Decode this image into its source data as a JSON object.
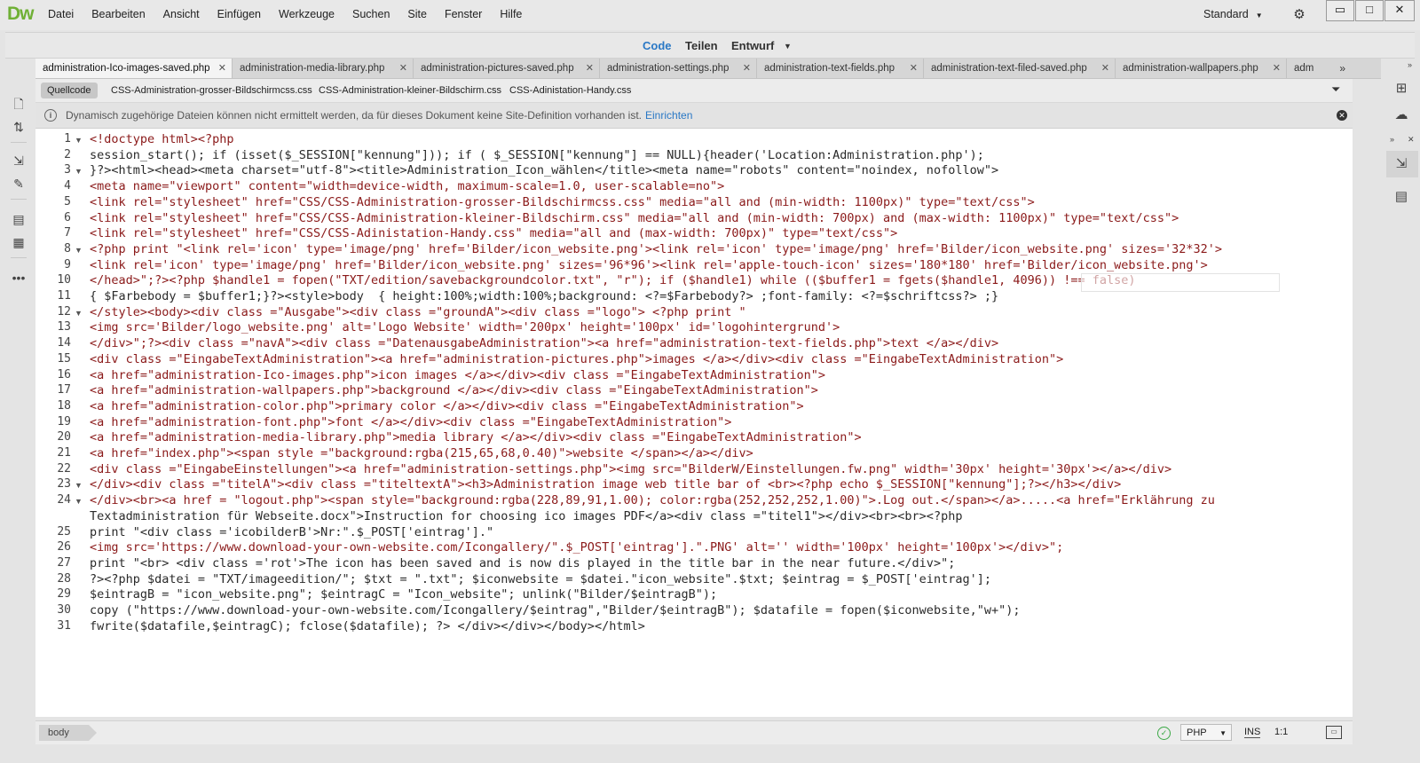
{
  "app": {
    "logo": "Dw",
    "menu": [
      "Datei",
      "Bearbeiten",
      "Ansicht",
      "Einfügen",
      "Werkzeuge",
      "Suchen",
      "Site",
      "Fenster",
      "Hilfe"
    ],
    "workspace": "Standard",
    "window_buttons": {
      "minimize": "▭",
      "maximize": "□",
      "close": "✕"
    }
  },
  "views": {
    "code": "Code",
    "split": "Teilen",
    "design": "Entwurf"
  },
  "tabs": [
    "administration-Ico-images-saved.php",
    "administration-media-library.php",
    "administration-pictures-saved.php",
    "administration-settings.php",
    "administration-text-fields.php",
    "administration-text-filed-saved.php",
    "administration-wallpapers.php",
    "adm"
  ],
  "tab_close": "✕",
  "tabs_more": "»",
  "related_files": [
    "Quellcode",
    "CSS-Administration-grosser-Bildschirmcss.css",
    "CSS-Administration-kleiner-Bildschirm.css",
    "CSS-Adinistation-Handy.css"
  ],
  "info_bar": {
    "message": "Dynamisch zugehörige Dateien können nicht ermittelt werden, da für dieses Dokument keine Site-Definition vorhanden ist.",
    "link": "Einrichten"
  },
  "code_lines": [
    {
      "n": "1",
      "fold": true,
      "text": "<!doctype html><?php"
    },
    {
      "n": "2",
      "fold": false,
      "text": "session_start(); if (isset($_SESSION[\"kennung\"])); if ( $_SESSION[\"kennung\"] == NULL){header('Location:Administration.php');"
    },
    {
      "n": "3",
      "fold": true,
      "text": "}?><html><head><meta charset=\"utf-8\"><title>Administration_Icon_wählen</title><meta name=\"robots\" content=\"noindex, nofollow\">"
    },
    {
      "n": "4",
      "fold": false,
      "text": "<meta name=\"viewport\" content=\"width=device-width, maximum-scale=1.0, user-scalable=no\">"
    },
    {
      "n": "5",
      "fold": false,
      "text": "<link rel=\"stylesheet\" href=\"CSS/CSS-Administration-grosser-Bildschirmcss.css\" media=\"all and (min-width: 1100px)\" type=\"text/css\">"
    },
    {
      "n": "6",
      "fold": false,
      "text": "<link rel=\"stylesheet\" href=\"CSS/CSS-Administration-kleiner-Bildschirm.css\" media=\"all and (min-width: 700px) and (max-width: 1100px)\" type=\"text/css\">"
    },
    {
      "n": "7",
      "fold": false,
      "text": "<link rel=\"stylesheet\" href=\"CSS/CSS-Adinistation-Handy.css\" media=\"all and (max-width: 700px)\" type=\"text/css\">"
    },
    {
      "n": "8",
      "fold": true,
      "text": "<?php print \"<link rel='icon' type='image/png' href='Bilder/icon_website.png'><link rel='icon' type='image/png' href='Bilder/icon_website.png' sizes='32*32'>"
    },
    {
      "n": "9",
      "fold": false,
      "text": "<link rel='icon' type='image/png' href='Bilder/icon_website.png' sizes='96*96'><link rel='apple-touch-icon' sizes='180*180' href='Bilder/icon_website.png'>"
    },
    {
      "n": "10",
      "fold": false,
      "text": "</head>\";?><?php $handle1 = fopen(\"TXT/edition/savebackgroundcolor.txt\", \"r\"); if ($handle1) while (($buffer1 = fgets($handle1, 4096)) !== false)"
    },
    {
      "n": "11",
      "fold": false,
      "text": "{ $Farbebody = $buffer1;}?><style>body  { height:100%;width:100%;background: <?=$Farbebody?> ;font-family: <?=$schriftcss?> ;}"
    },
    {
      "n": "12",
      "fold": true,
      "text": "</style><body><div class =\"Ausgabe\"><div class =\"groundA\"><div class =\"logo\"> <?php print \""
    },
    {
      "n": "13",
      "fold": false,
      "text": "<img src='Bilder/logo_website.png' alt='Logo Website' width='200px' height='100px' id='logohintergrund'>"
    },
    {
      "n": "14",
      "fold": false,
      "text": "</div>\";?><div class =\"navA\"><div class =\"DatenausgabeAdministration\"><a href=\"administration-text-fields.php\">text </a></div>"
    },
    {
      "n": "15",
      "fold": false,
      "text": "<div class =\"EingabeTextAdministration\"><a href=\"administration-pictures.php\">images </a></div><div class =\"EingabeTextAdministration\">"
    },
    {
      "n": "16",
      "fold": false,
      "text": "<a href=\"administration-Ico-images.php\">icon images </a></div><div class =\"EingabeTextAdministration\">"
    },
    {
      "n": "17",
      "fold": false,
      "text": "<a href=\"administration-wallpapers.php\">background </a></div><div class =\"EingabeTextAdministration\">"
    },
    {
      "n": "18",
      "fold": false,
      "text": "<a href=\"administration-color.php\">primary color </a></div><div class =\"EingabeTextAdministration\">"
    },
    {
      "n": "19",
      "fold": false,
      "text": "<a href=\"administration-font.php\">font </a></div><div class =\"EingabeTextAdministration\">"
    },
    {
      "n": "20",
      "fold": false,
      "text": "<a href=\"administration-media-library.php\">media library </a></div><div class =\"EingabeTextAdministration\">"
    },
    {
      "n": "21",
      "fold": false,
      "text": "<a href=\"index.php\"><span style =\"background:rgba(215,65,68,0.40)\">website </span></a></div>"
    },
    {
      "n": "22",
      "fold": false,
      "text": "<div class =\"EingabeEinstellungen\"><a href=\"administration-settings.php\"><img src=\"BilderW/Einstellungen.fw.png\" width='30px' height='30px'></a></div>"
    },
    {
      "n": "23",
      "fold": true,
      "text": "</div><div class =\"titelA\"><div class =\"titeltextA\"><h3>Administration image web title bar of <br><?php echo $_SESSION[\"kennung\"];?></h3></div>"
    },
    {
      "n": "24",
      "fold": true,
      "text": "</div><br><a href = \"logout.php\"><span style=\"background:rgba(228,89,91,1.00); color:rgba(252,252,252,1.00)\">.Log out.</span></a>.....<a href=\"Erklährung zu"
    },
    {
      "n": "",
      "fold": false,
      "text": "Textadministration für Webseite.docx\">Instruction for choosing ico images PDF</a><div class =\"titel1\"></div><br><br><?php"
    },
    {
      "n": "25",
      "fold": false,
      "text": "print \"<div class ='icobilderB'>Nr:\".$_POST['eintrag'].\""
    },
    {
      "n": "26",
      "fold": false,
      "text": "<img src='https://www.download-your-own-website.com/Icongallery/\".$_POST['eintrag'].\".PNG' alt='' width='100px' height='100px'></div>\";"
    },
    {
      "n": "27",
      "fold": false,
      "text": "print \"<br> <div class ='rot'>The icon has been saved and is now dis played in the title bar in the near future.</div>\";"
    },
    {
      "n": "28",
      "fold": false,
      "text": "?><?php $datei = \"TXT/imageedition/\"; $txt = \".txt\"; $iconwebsite = $datei.\"icon_website\".$txt; $eintrag = $_POST['eintrag'];"
    },
    {
      "n": "29",
      "fold": false,
      "text": "$eintragB = \"icon_website.png\"; $eintragC = \"Icon_website\"; unlink(\"Bilder/$eintragB\");"
    },
    {
      "n": "30",
      "fold": false,
      "text": "copy (\"https://www.download-your-own-website.com/Icongallery/$eintrag\",\"Bilder/$eintragB\"); $datafile = fopen($iconwebsite,\"w+\");"
    },
    {
      "n": "31",
      "fold": false,
      "text": "fwrite($datafile,$eintragC); fclose($datafile); ?> </div></div></body></html>"
    }
  ],
  "status": {
    "breadcrumb": "body",
    "language": "PHP",
    "mode": "INS",
    "cursor": "1:1"
  },
  "colors": {
    "accent": "#2a78c5",
    "logo": "#6fb035",
    "ok": "#3aa845"
  }
}
